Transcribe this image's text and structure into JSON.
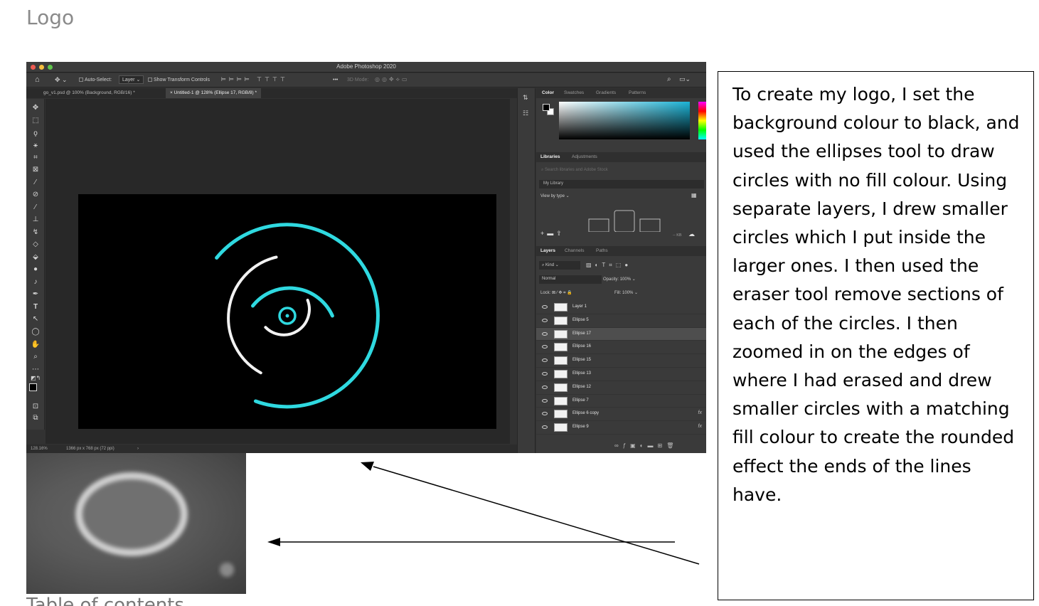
{
  "document": {
    "heading": "Logo",
    "cut_heading": "Table of contents"
  },
  "photoshop": {
    "app_title": "Adobe Photoshop 2020",
    "options_bar": {
      "auto_select_label": "Auto-Select:",
      "auto_select_value": "Layer",
      "show_transform_label": "Show Transform Controls",
      "mode_3d": "3D Mode:",
      "more": "•••"
    },
    "doc_tabs": [
      {
        "label": "go_v1.psd @ 100% (Background, RGB/16) *"
      },
      {
        "label": "Untitled-1 @ 128% (Ellipse 17, RGB/8) *"
      }
    ],
    "status_bar": {
      "zoom": "128.16%",
      "doc_info": "1366 px x 768 px (72 ppi)"
    },
    "color_panel": {
      "tabs": [
        "Color",
        "Swatches",
        "Gradients",
        "Patterns"
      ],
      "active_tab": "Color"
    },
    "libraries_panel": {
      "tabs": [
        "Libraries",
        "Adjustments"
      ],
      "search_placeholder": "Search libraries and Adobe Stock",
      "library_select": "My Library",
      "view_by": "View by type",
      "size_label": "-- KB"
    },
    "layers_panel": {
      "tabs": [
        "Layers",
        "Channels",
        "Paths"
      ],
      "filter_kind": "Kind",
      "blend_mode": "Normal",
      "opacity_label": "Opacity:",
      "opacity_value": "100%",
      "lock_label": "Lock:",
      "fill_label": "Fill:",
      "fill_value": "100%",
      "layers": [
        {
          "name": "Layer 1",
          "selected": false,
          "fx": ""
        },
        {
          "name": "Ellipse 5",
          "selected": false,
          "fx": ""
        },
        {
          "name": "Ellipse 17",
          "selected": true,
          "fx": ""
        },
        {
          "name": "Ellipse 16",
          "selected": false,
          "fx": ""
        },
        {
          "name": "Ellipse 15",
          "selected": false,
          "fx": ""
        },
        {
          "name": "Ellipse 13",
          "selected": false,
          "fx": ""
        },
        {
          "name": "Ellipse 12",
          "selected": false,
          "fx": ""
        },
        {
          "name": "Ellipse 7",
          "selected": false,
          "fx": ""
        },
        {
          "name": "Ellipse 6 copy",
          "selected": false,
          "fx": "fx"
        },
        {
          "name": "Ellipse 9",
          "selected": false,
          "fx": "fx"
        }
      ]
    },
    "artwork_colors": {
      "cyan": "#2fd9e0",
      "white": "#f2f2f2",
      "background": "#000000"
    }
  },
  "description": {
    "text": "To create my logo, I set the background colour to black, and used the ellipses tool to draw circles with no fill colour. Using separate layers, I drew smaller circles which I put inside the larger ones. I then used the eraser tool remove sections of each of the circles. I then zoomed in on the edges of where I had erased and drew smaller circles with a matching fill colour to create the rounded effect the ends of the lines have."
  }
}
